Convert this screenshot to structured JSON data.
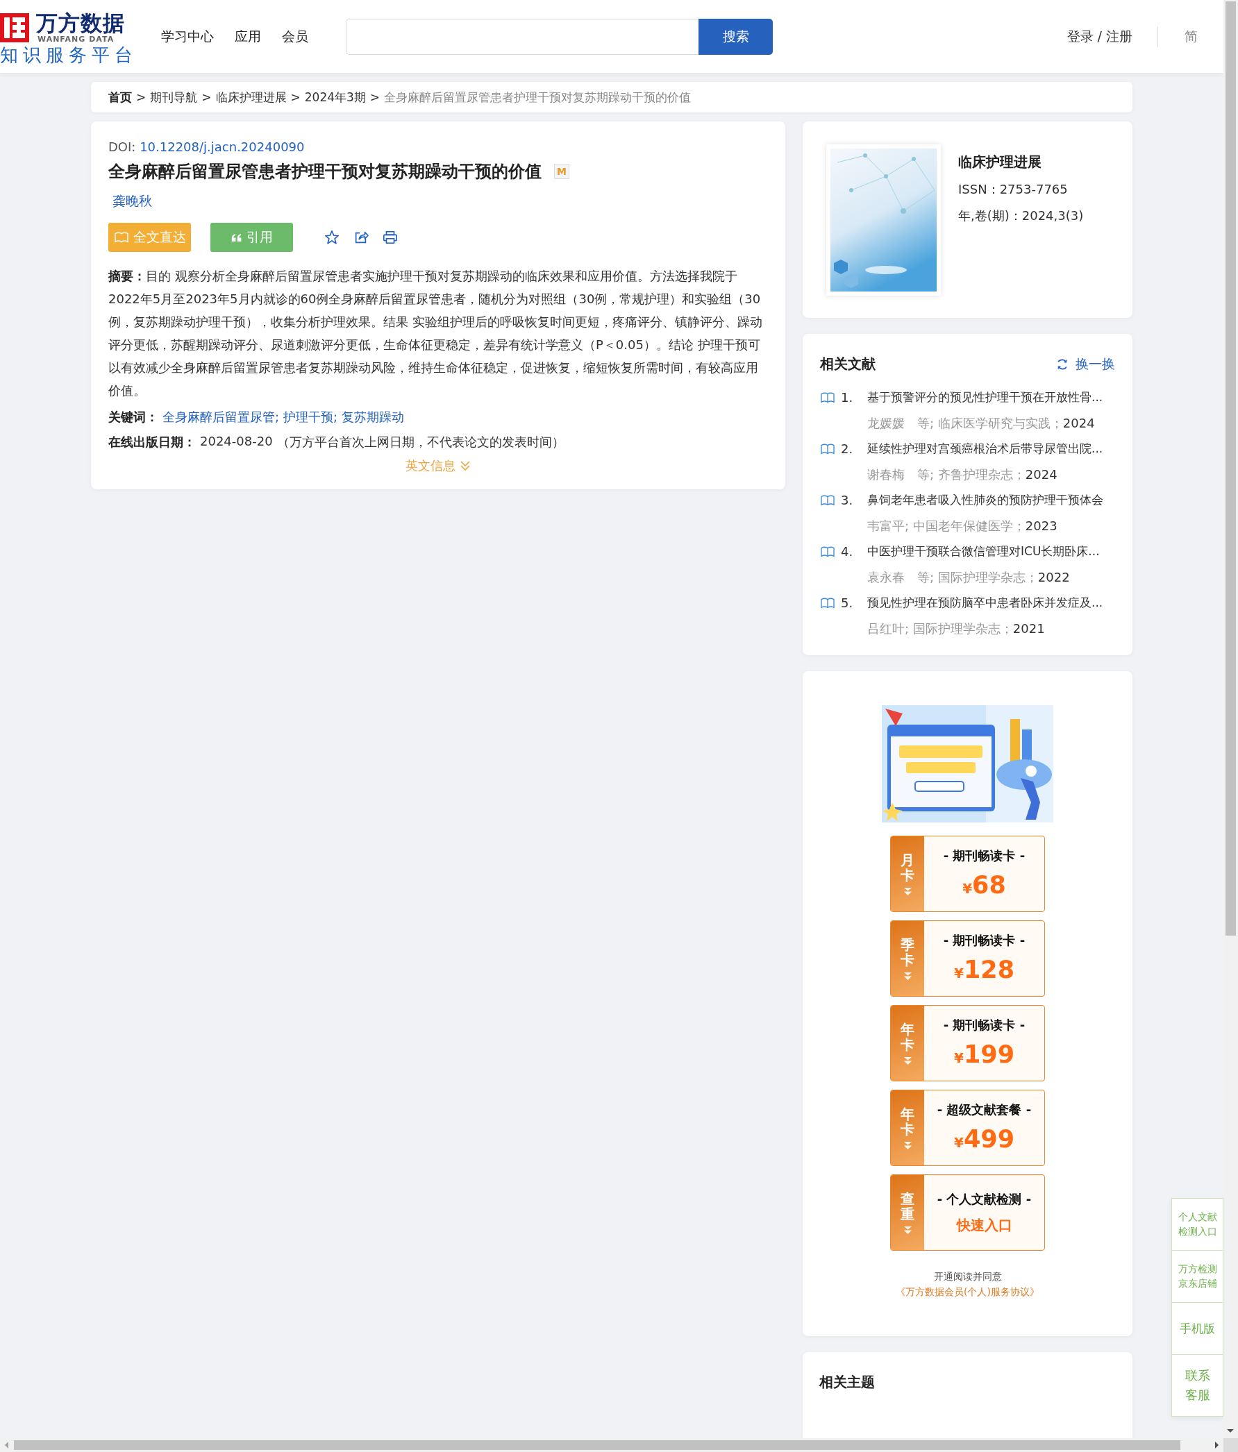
{
  "header": {
    "logo_name": "万方数据",
    "logo_english": "WANFANG DATA",
    "logo_tagline": "知识服务平台",
    "nav": [
      "学习中心",
      "应用",
      "会员"
    ],
    "search": {
      "button": "搜索"
    },
    "login": "登录 / 注册",
    "language": "简"
  },
  "breadcrumb": {
    "items": [
      {
        "label": "首页",
        "kind": "home"
      },
      {
        "label": "期刊导航",
        "kind": "link"
      },
      {
        "label": "临床护理进展",
        "kind": "link"
      },
      {
        "label": "2024年3期",
        "kind": "link"
      },
      {
        "label": "全身麻醉后留置尿管患者护理干预对复苏期躁动干预的价值",
        "kind": "current"
      }
    ],
    "separators": [
      ">",
      ">",
      ">",
      ">"
    ]
  },
  "article": {
    "doi_label": "DOI:",
    "doi": "10.12208/j.jacn.20240090",
    "title": "全身麻醉后留置尿管患者护理干预对复苏期躁动干预的价值",
    "badge": "M",
    "author": "龚晚秋",
    "buttons": [
      {
        "label": "全文直达",
        "kind": "fulltext"
      },
      {
        "label": "引用",
        "kind": "cite"
      }
    ],
    "abstract_label": "摘要：",
    "abstract": "目的 观察分析全身麻醉后留置尿管患者实施护理干预对复苏期躁动的临床效果和应用价值。方法选择我院于2022年5月至2023年5月内就诊的60例全身麻醉后留置尿管患者，随机分为对照组（30例，常规护理）和实验组（30例，复苏期躁动护理干预），收集分析护理效果。结果 实验组护理后的呼吸恢复时间更短，疼痛评分、镇静评分、躁动评分更低，苏醒期躁动评分、尿道刺激评分更低，生命体征更稳定，差异有统计学意义（P＜0.05）。结论 护理干预可以有效减少全身麻醉后留置尿管患者复苏期躁动风险，维持生命体征稳定，促进恢复，缩短恢复所需时间，有较高应用价值。",
    "keywords_label": "关键词：",
    "keywords": [
      "全身麻醉后留置尿管;",
      "护理干预;",
      "复苏期躁动"
    ],
    "date_label": "在线出版日期：",
    "date": "2024-08-20",
    "date_note": "（万方平台首次上网日期，不代表论文的发表时间）",
    "english": {
      "label": "英文信息",
      "expanded": false
    }
  },
  "journal": {
    "name": "临床护理进展",
    "issn": "ISSN：2753-7765",
    "issue": "年,卷(期)：2024,3(3)"
  },
  "related": {
    "title": "相关文献",
    "refresh": "换一换",
    "items": [
      {
        "number": "1.",
        "title": "基于预警评分的预见性护理干预在开放性骨...",
        "meta": "龙媛媛　等; 临床医学研究与实践；",
        "year": "2024"
      },
      {
        "number": "2.",
        "title": "延续性护理对宫颈癌根治术后带导尿管出院...",
        "meta": "谢春梅　等; 齐鲁护理杂志；",
        "year": "2024"
      },
      {
        "number": "3.",
        "title": "鼻饲老年患者吸入性肺炎的预防护理干预体会",
        "meta": "韦富平; 中国老年保健医学；",
        "year": "2023"
      },
      {
        "number": "4.",
        "title": "中医护理干预联合微信管理对ICU长期卧床...",
        "meta": "袁永春　等; 国际护理学杂志；",
        "year": "2022"
      },
      {
        "number": "5.",
        "title": "预见性护理在预防脑卒中患者卧床并发症及...",
        "meta": "吕红叶; 国际护理学杂志；",
        "year": "2021"
      }
    ]
  },
  "promo": {
    "cards": [
      {
        "kind": "price",
        "tag": "月卡",
        "name": "- 期刊畅读卡 -",
        "currency": "¥",
        "price": "68"
      },
      {
        "kind": "price",
        "tag": "季卡",
        "name": "- 期刊畅读卡 -",
        "currency": "¥",
        "price": "128"
      },
      {
        "kind": "price",
        "tag": "年卡",
        "name": "- 期刊畅读卡 -",
        "currency": "¥",
        "price": "199"
      },
      {
        "kind": "price",
        "tag": "年卡",
        "name": "- 超级文献套餐 -",
        "currency": "¥",
        "price": "499"
      },
      {
        "kind": "entry",
        "tag": "查重",
        "name": "- 个人文献检测 -",
        "action": "快速入口"
      }
    ],
    "agree_text": "开通阅读并同意",
    "agreement": "《万方数据会员(个人)服务协议》"
  },
  "topics": {
    "title": "相关主题"
  },
  "float_panel": [
    {
      "kind": "small",
      "label": "个人文献检测入口"
    },
    {
      "kind": "small",
      "label": "万方检测京东店铺"
    },
    {
      "kind": "single",
      "label": "手机版"
    },
    {
      "kind": "pair",
      "label": "联系客服"
    }
  ]
}
